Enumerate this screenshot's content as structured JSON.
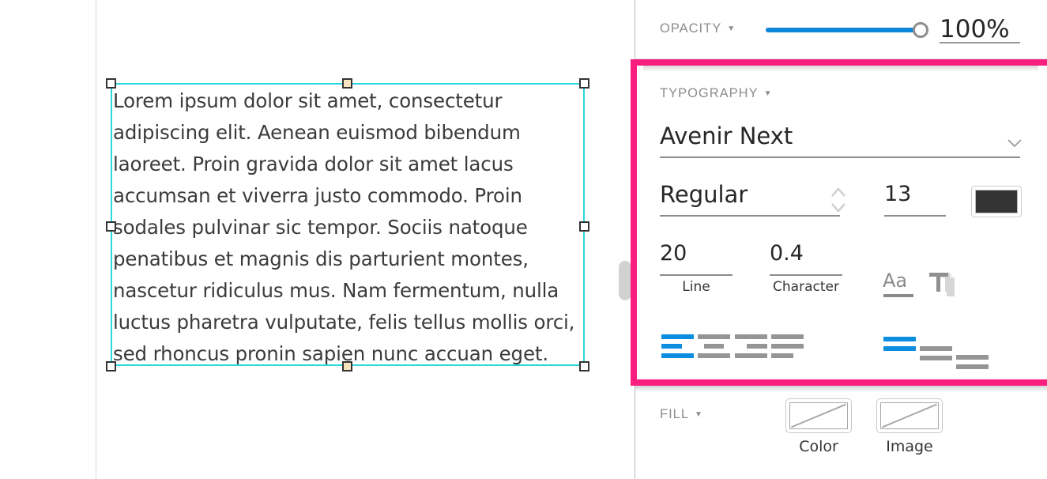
{
  "canvas": {
    "text_object": {
      "content": "Lorem ipsum dolor sit amet, consectetur adipiscing elit. Aenean euismod bibendum laoreet. Proin gravida dolor sit amet lacus accumsan et viverra justo commodo. Proin sodales pulvinar sic tempor. Sociis natoque penatibus et magnis dis parturient montes, nascetur ridiculus mus. Nam fermentum, nulla luctus pharetra vulputate, felis tellus mollis orci, sed rhoncus pronin sapien nunc accuan eget.",
      "selection_color": "#2bd6dd",
      "handle_fill": "#ffffff",
      "handle_active_fill": "#f7e3bd"
    }
  },
  "panel": {
    "opacity": {
      "label": "OPACITY",
      "caret": "▼",
      "value": "100%",
      "slider_percent": 96,
      "slider_color": "#0c87d8"
    },
    "typography": {
      "label": "TYPOGRAPHY",
      "caret": "▼",
      "highlight_color": "#f91e7f",
      "font_family": "Avenir Next",
      "font_weight": "Regular",
      "font_size": "13",
      "font_color": "#343434",
      "line_spacing": "20",
      "line_caption": "Line",
      "character_spacing": "0.4",
      "character_caption": "Character",
      "case_icon_label": "Aa",
      "horizontal_align": [
        {
          "name": "align-left",
          "selected": true
        },
        {
          "name": "align-center",
          "selected": false
        },
        {
          "name": "align-right",
          "selected": false
        },
        {
          "name": "align-justify",
          "selected": false
        }
      ],
      "vertical_align": [
        {
          "name": "align-top",
          "selected": true
        },
        {
          "name": "align-middle",
          "selected": false
        },
        {
          "name": "align-bottom",
          "selected": false
        }
      ]
    },
    "fill": {
      "label": "FILL",
      "caret": "▼",
      "options": [
        {
          "name": "color",
          "caption": "Color"
        },
        {
          "name": "image",
          "caption": "Image"
        }
      ]
    }
  }
}
